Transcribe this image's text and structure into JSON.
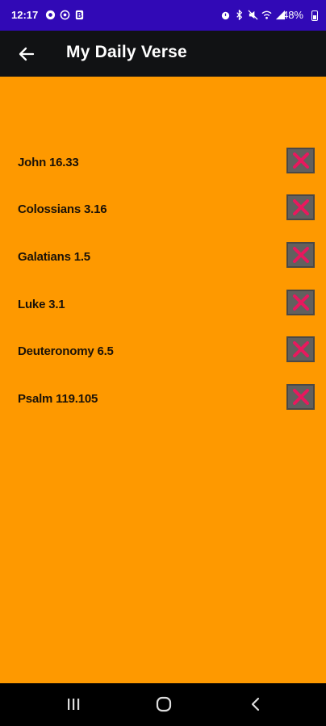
{
  "status_bar": {
    "time": "12:17",
    "battery": "48%",
    "left_icons": [
      "sync-icon",
      "vpn-icon",
      "b-app-icon"
    ],
    "right_icons": [
      "alarm-icon",
      "bluetooth-icon",
      "mute-icon",
      "wifi-icon",
      "signal-icon"
    ]
  },
  "app_bar": {
    "title": "My Daily Verse",
    "back_icon": "back-arrow-icon"
  },
  "verses": [
    {
      "reference": "John 16.33"
    },
    {
      "reference": "Colossians 3.16"
    },
    {
      "reference": "Galatians 1.5"
    },
    {
      "reference": "Luke 3.1"
    },
    {
      "reference": "Deuteronomy 6.5"
    },
    {
      "reference": "Psalm 119.105"
    }
  ],
  "nav_bar": {
    "buttons": [
      "recent-apps-icon",
      "home-icon",
      "back-icon"
    ]
  },
  "colors": {
    "status_bar": "#3109b6",
    "app_bar": "#111214",
    "content_bg": "#fe9900",
    "delete_button_bg": "#62605e",
    "delete_x": "#e8185e"
  }
}
